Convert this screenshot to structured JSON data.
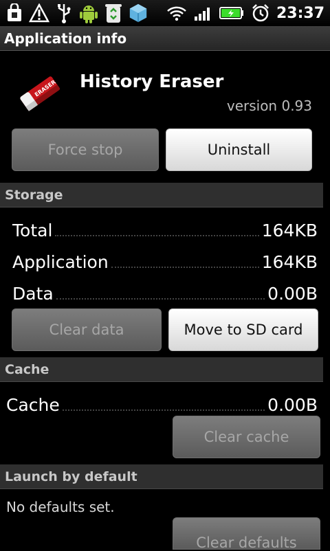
{
  "status_bar": {
    "time": "23:37",
    "icons": [
      "bag-icon",
      "warning-icon",
      "usb-icon",
      "android-icon",
      "recycle-icon",
      "cube-icon",
      "wifi-icon",
      "signal-icon",
      "battery-charging-icon",
      "alarm-icon"
    ]
  },
  "title_bar": {
    "title": "Application info"
  },
  "app": {
    "name": "History Eraser",
    "version": "version 0.93",
    "icon": "eraser-icon",
    "icon_text": "ERASER"
  },
  "actions": {
    "force_stop": "Force stop",
    "uninstall": "Uninstall"
  },
  "storage": {
    "header": "Storage",
    "rows": [
      {
        "label": "Total",
        "value": "164KB"
      },
      {
        "label": "Application",
        "value": "164KB"
      },
      {
        "label": "Data",
        "value": "0.00B"
      }
    ],
    "clear_data": "Clear data",
    "move_to_sd": "Move to SD card"
  },
  "cache": {
    "header": "Cache",
    "label": "Cache",
    "value": "0.00B",
    "clear_cache": "Clear cache"
  },
  "launch": {
    "header": "Launch by default",
    "text": "No defaults set.",
    "clear_defaults": "Clear defaults"
  },
  "colors": {
    "battery_green": "#3bdc2b",
    "disabled_button": "#6a6a6a",
    "enabled_button": "#efefef",
    "section_bg": "#2f2f2f"
  }
}
